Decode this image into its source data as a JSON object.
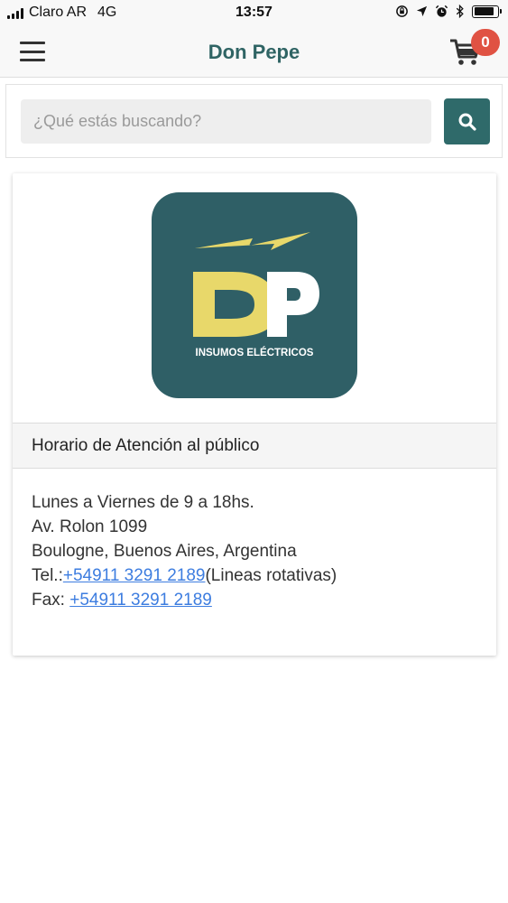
{
  "status_bar": {
    "carrier": "Claro AR",
    "network": "4G",
    "time": "13:57"
  },
  "header": {
    "title": "Don Pepe",
    "cart_count": "0"
  },
  "search": {
    "placeholder": "¿Qué estás buscando?"
  },
  "logo": {
    "letters": "DP",
    "tagline": "INSUMOS ELÉCTRICOS",
    "colors": {
      "background": "#2f5f66",
      "yellow": "#e8d86a",
      "white": "#ffffff"
    }
  },
  "info_card": {
    "header": "Horario de Atención al público",
    "hours": "Lunes a Viernes de 9 a 18hs.",
    "address_line1": "Av. Rolon 1099",
    "address_line2": "Boulogne, Buenos Aires, Argentina",
    "tel_label": "Tel.:",
    "tel_number": "+54911 3291 2189",
    "tel_note": "(Lineas rotativas)",
    "fax_label": "Fax: ",
    "fax_number": "+54911 3291 2189"
  },
  "colors": {
    "brand": "#2f6464",
    "search_button": "#2f6a6a",
    "badge": "#e05243",
    "link": "#3d7de0"
  }
}
